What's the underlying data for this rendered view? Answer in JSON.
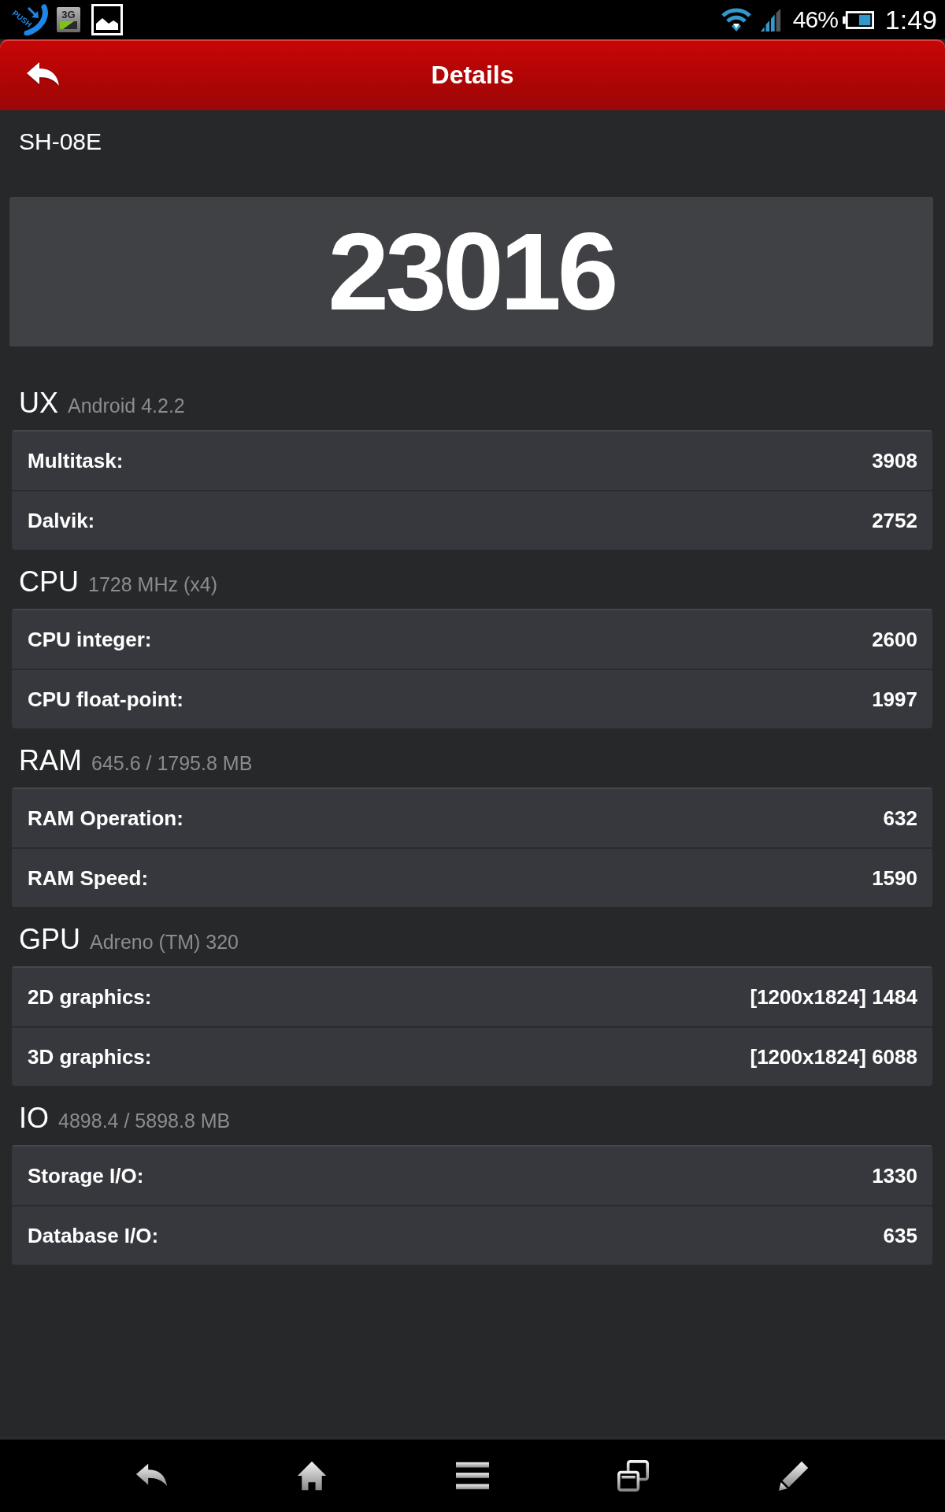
{
  "status_bar": {
    "notifications": [
      {
        "kind": "push",
        "label": "PUSH"
      },
      {
        "kind": "network",
        "label": "3G"
      },
      {
        "kind": "image"
      }
    ],
    "battery_text": "46%",
    "time": "1:49"
  },
  "title_bar": {
    "title": "Details"
  },
  "device": "SH-08E",
  "score": "23016",
  "sections": [
    {
      "name": "UX",
      "detail": "Android 4.2.2",
      "rows": [
        {
          "label": "Multitask:",
          "value": "3908"
        },
        {
          "label": "Dalvik:",
          "value": "2752"
        }
      ]
    },
    {
      "name": "CPU",
      "detail": "1728 MHz (x4)",
      "rows": [
        {
          "label": "CPU integer:",
          "value": "2600"
        },
        {
          "label": "CPU float-point:",
          "value": "1997"
        }
      ]
    },
    {
      "name": "RAM",
      "detail": "645.6 / 1795.8 MB",
      "rows": [
        {
          "label": "RAM Operation:",
          "value": "632"
        },
        {
          "label": "RAM Speed:",
          "value": "1590"
        }
      ]
    },
    {
      "name": "GPU",
      "detail": "Adreno (TM) 320",
      "rows": [
        {
          "label": "2D graphics:",
          "value": "[1200x1824] 1484"
        },
        {
          "label": "3D graphics:",
          "value": "[1200x1824] 6088"
        }
      ]
    },
    {
      "name": "IO",
      "detail": "4898.4 / 5898.8 MB",
      "rows": [
        {
          "label": "Storage I/O:",
          "value": "1330"
        },
        {
          "label": "Database I/O:",
          "value": "635"
        }
      ]
    }
  ],
  "nav_bar": {
    "buttons": [
      {
        "kind": "back"
      },
      {
        "kind": "home"
      },
      {
        "kind": "menu"
      },
      {
        "kind": "recent"
      },
      {
        "kind": "edit"
      }
    ]
  }
}
